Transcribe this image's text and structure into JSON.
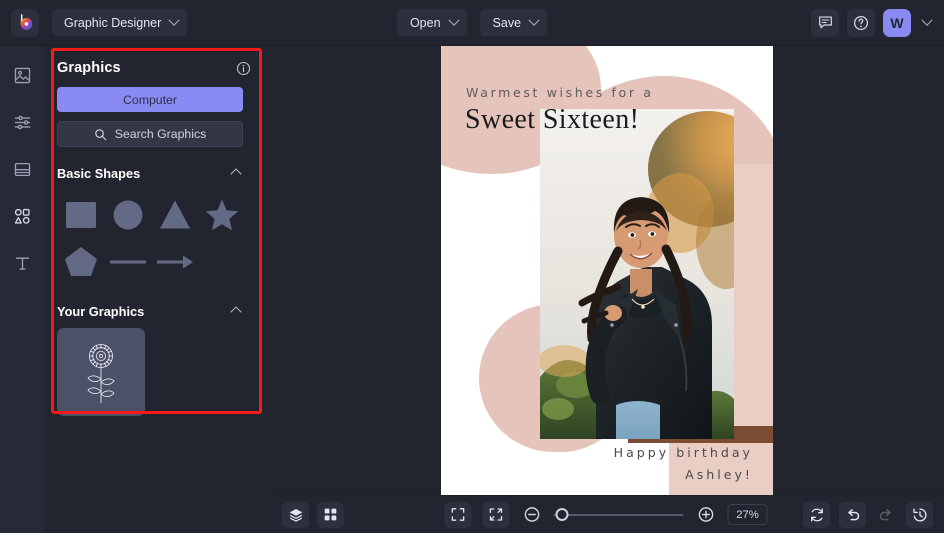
{
  "app": {
    "logo_icon": "bee-logo-icon",
    "document_name": "Graphic Designer"
  },
  "topbar": {
    "open_label": "Open",
    "save_label": "Save",
    "comments_icon": "comment-icon",
    "help_icon": "help-circle-icon",
    "avatar_initial": "W",
    "avatar_chevron_icon": "chevron-down-icon"
  },
  "rail": {
    "items": [
      {
        "name": "images",
        "icon": "image-icon"
      },
      {
        "name": "adjust",
        "icon": "sliders-icon"
      },
      {
        "name": "layout",
        "icon": "layout-icon"
      },
      {
        "name": "graphics",
        "icon": "shapes-icon"
      },
      {
        "name": "text",
        "icon": "text-icon"
      }
    ]
  },
  "panel": {
    "title": "Graphics",
    "info_icon": "info-icon",
    "computer_button": "Computer",
    "search_placeholder": "Search Graphics",
    "search_icon": "search-icon",
    "sections": [
      {
        "title": "Basic Shapes",
        "collapse_icon": "chevron-up-icon",
        "shapes": [
          "square-shape",
          "circle-shape",
          "triangle-shape",
          "star-shape",
          "pentagon-shape",
          "line-shape",
          "arrow-shape"
        ]
      },
      {
        "title": "Your Graphics",
        "collapse_icon": "chevron-up-icon",
        "items": [
          "flower-graphic"
        ]
      }
    ]
  },
  "canvas": {
    "greeting_line": "Warmest wishes for a",
    "headline": "Sweet Sixteen!",
    "footer_line1": "Happy birthday",
    "footer_line2": "Ashley!",
    "photo_alt": "smiling-young-woman-leather-jacket-photo"
  },
  "bottombar": {
    "layers_icon": "layers-icon",
    "grid_icon": "grid-icon",
    "fit_icon": "fit-screen-icon",
    "shrink_icon": "shrink-to-fit-icon",
    "zoom_out_icon": "zoom-out-icon",
    "zoom_in_icon": "zoom-in-icon",
    "zoom_value": "27%",
    "reset_icon": "reset-icon",
    "undo_icon": "undo-icon",
    "redo_icon": "redo-icon",
    "history_icon": "history-icon"
  },
  "colors": {
    "accent": "#8a8bf2",
    "annotation": "#f51b1b",
    "panel_bg": "#22242f",
    "rail_bg": "#272a36",
    "blush": "#e5c5bb",
    "brown": "#7b4b32"
  }
}
